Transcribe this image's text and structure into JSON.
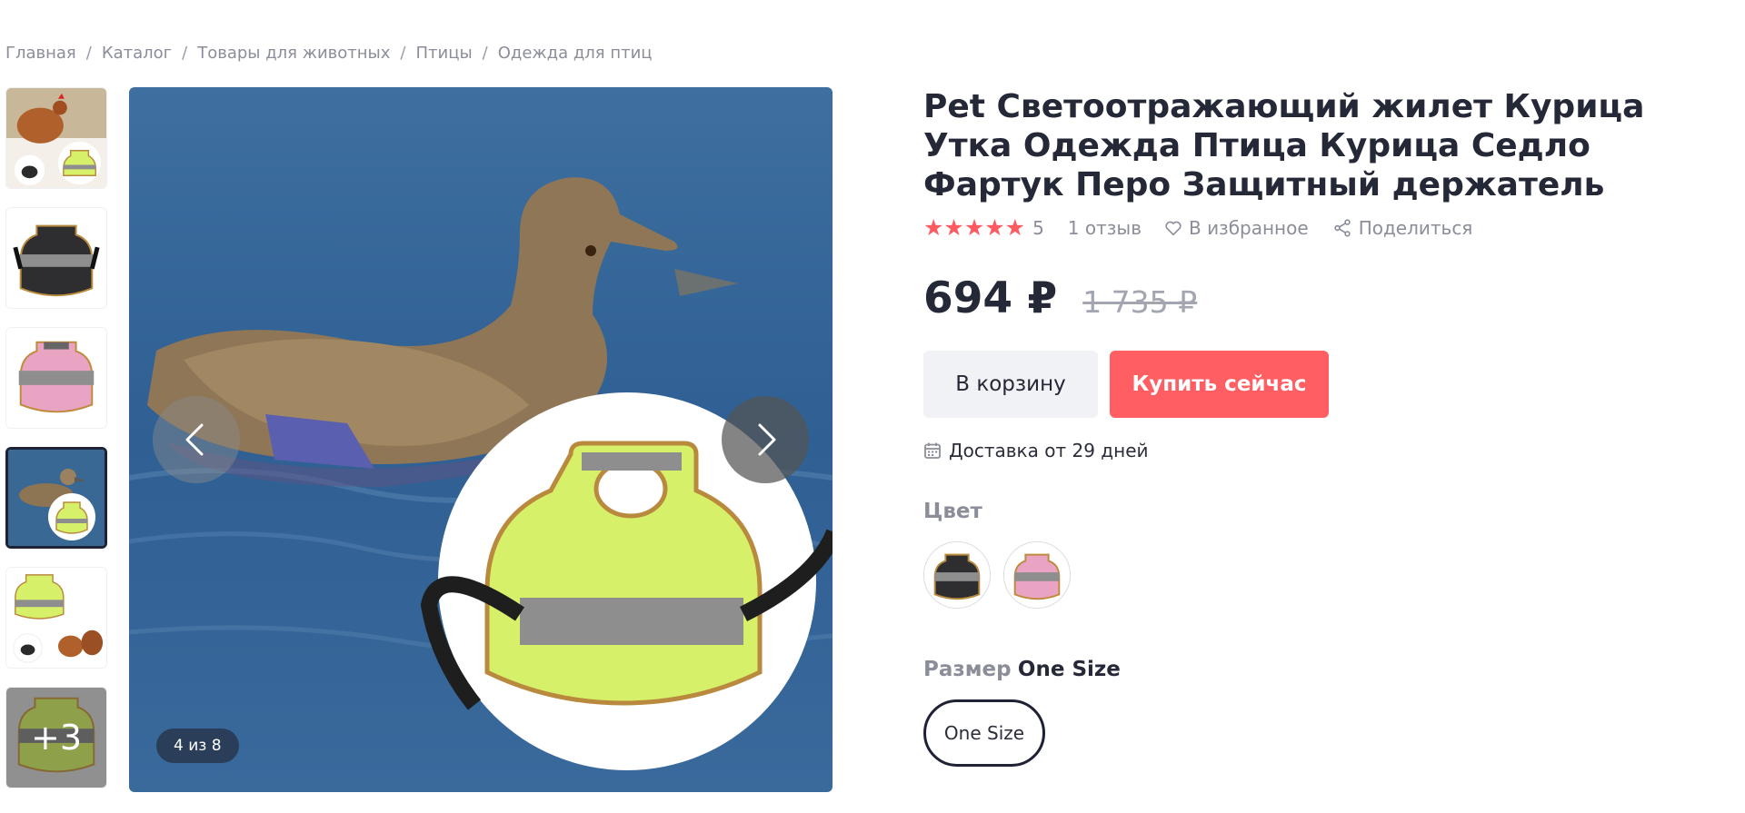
{
  "breadcrumb": [
    "Главная",
    "Каталог",
    "Товары для животных",
    "Птицы",
    "Одежда для птиц"
  ],
  "breadcrumb_separator": "/",
  "gallery": {
    "counter": "4 из 8",
    "more_label": "+3",
    "thumbnails": [
      "chicken-vest-yellow",
      "vest-black",
      "vest-pink",
      "duck-vest-yellow",
      "vest-yellow-chickens",
      "vest-yellow-more"
    ],
    "active_index": 3
  },
  "product": {
    "title": "Pet Светоотражающий жилет Курица Утка Одежда Птица Курица Седло Фартук Перо Защитный держатель",
    "rating": "5",
    "stars": "★★★★★",
    "reviews": "1 отзыв",
    "favorite": "В избранное",
    "share": "Поделиться",
    "price": "694 ₽",
    "old_price": "1 735 ₽",
    "cart_button": "В корзину",
    "buy_button": "Купить сейчас",
    "delivery": "Доставка от 29 дней",
    "color_label": "Цвет",
    "colors": [
      "black",
      "pink"
    ],
    "size_label": "Размер",
    "size_value": "One Size",
    "size_options": [
      "One Size"
    ]
  },
  "colors": {
    "accent": "#ff5f63",
    "star": "#ff5a5f",
    "text": "#252836",
    "muted": "#8b8e99",
    "vest_yellow": "#d7f06a",
    "vest_gray": "#8e8e8e"
  }
}
